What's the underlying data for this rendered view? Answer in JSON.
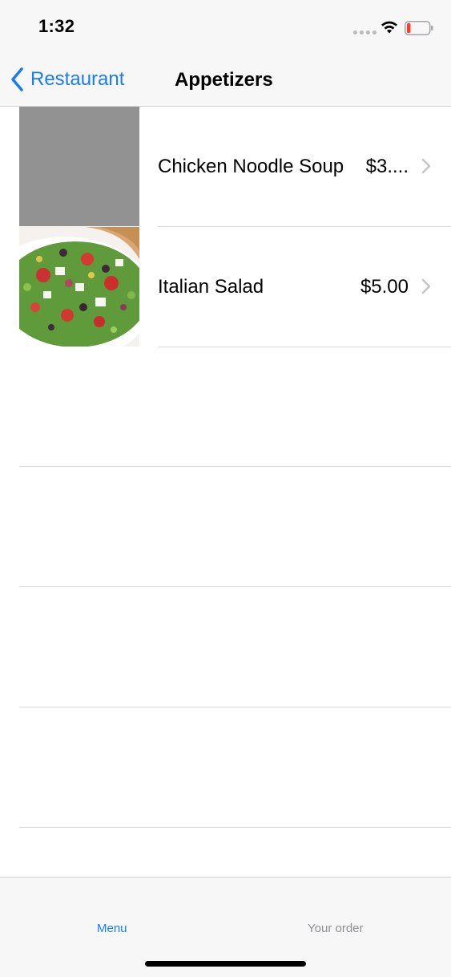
{
  "status_bar": {
    "time": "1:32",
    "icons": [
      "signal-dots-icon",
      "wifi-icon",
      "battery-low-icon"
    ],
    "battery_color": "#ff3b30"
  },
  "nav": {
    "back_label": "Restaurant",
    "title": "Appetizers",
    "accent_color": "#1a7cf2"
  },
  "items": [
    {
      "name": "Chicken Noodle Soup",
      "price": "$3....",
      "image": "placeholder-gray"
    },
    {
      "name": "Italian Salad",
      "price": "$5.00",
      "image": "salad-photo"
    }
  ],
  "tabs": [
    {
      "label": "Menu",
      "selected": true
    },
    {
      "label": "Your order",
      "selected": false
    }
  ]
}
